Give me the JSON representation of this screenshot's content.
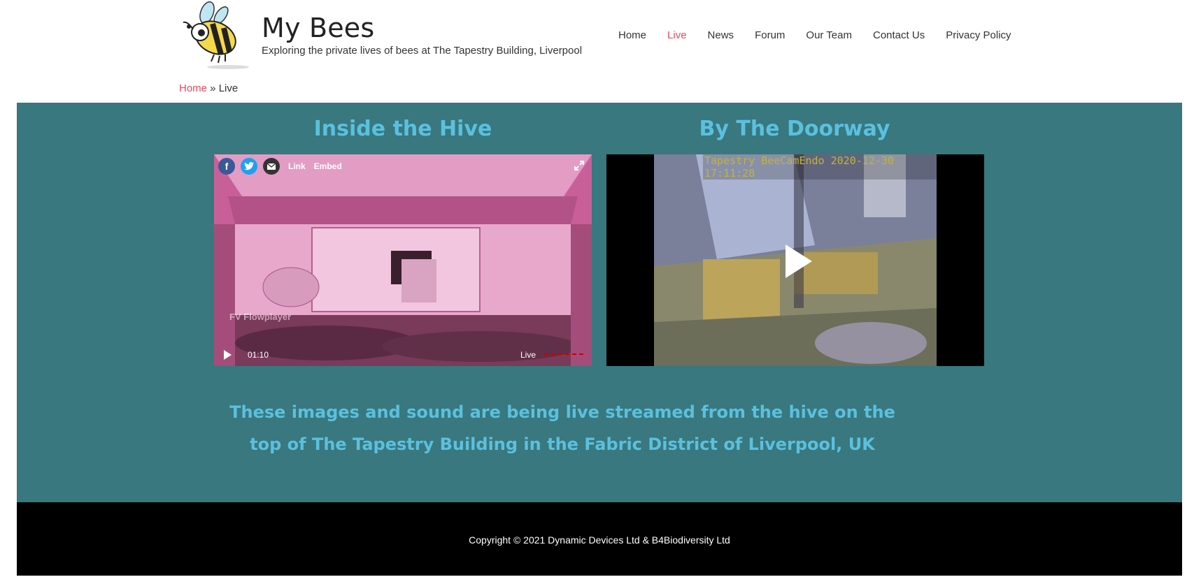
{
  "site": {
    "title": "My Bees",
    "tagline": "Exploring the private lives of bees at The Tapestry Building, Liverpool"
  },
  "nav": {
    "items": [
      {
        "label": "Home"
      },
      {
        "label": "Live",
        "active": true
      },
      {
        "label": "News"
      },
      {
        "label": "Forum"
      },
      {
        "label": "Our Team"
      },
      {
        "label": "Contact Us"
      },
      {
        "label": "Privacy Policy"
      }
    ]
  },
  "breadcrumb": {
    "home": "Home",
    "separator": " » ",
    "current": "Live"
  },
  "videos": {
    "hive": {
      "title": "Inside the Hive",
      "link_label": "Link",
      "embed_label": "Embed",
      "watermark": "FV Flowplayer",
      "time": "01:10",
      "live_label": "Live"
    },
    "door": {
      "title": "By The Doorway",
      "stamp": "Tapestry BeeCamEndo 2020-12-30 17:11:28"
    }
  },
  "stream_text": "These images and sound are being live streamed from the hive on the top of The Tapestry Building in the Fabric District of Liverpool, UK",
  "footer": {
    "copyright": "Copyright © 2021 Dynamic Devices Ltd & B4Biodiversity Ltd"
  },
  "colors": {
    "accent": "#e8475f",
    "band": "#38787e",
    "heading": "#5bc0de",
    "footer": "#000000"
  }
}
